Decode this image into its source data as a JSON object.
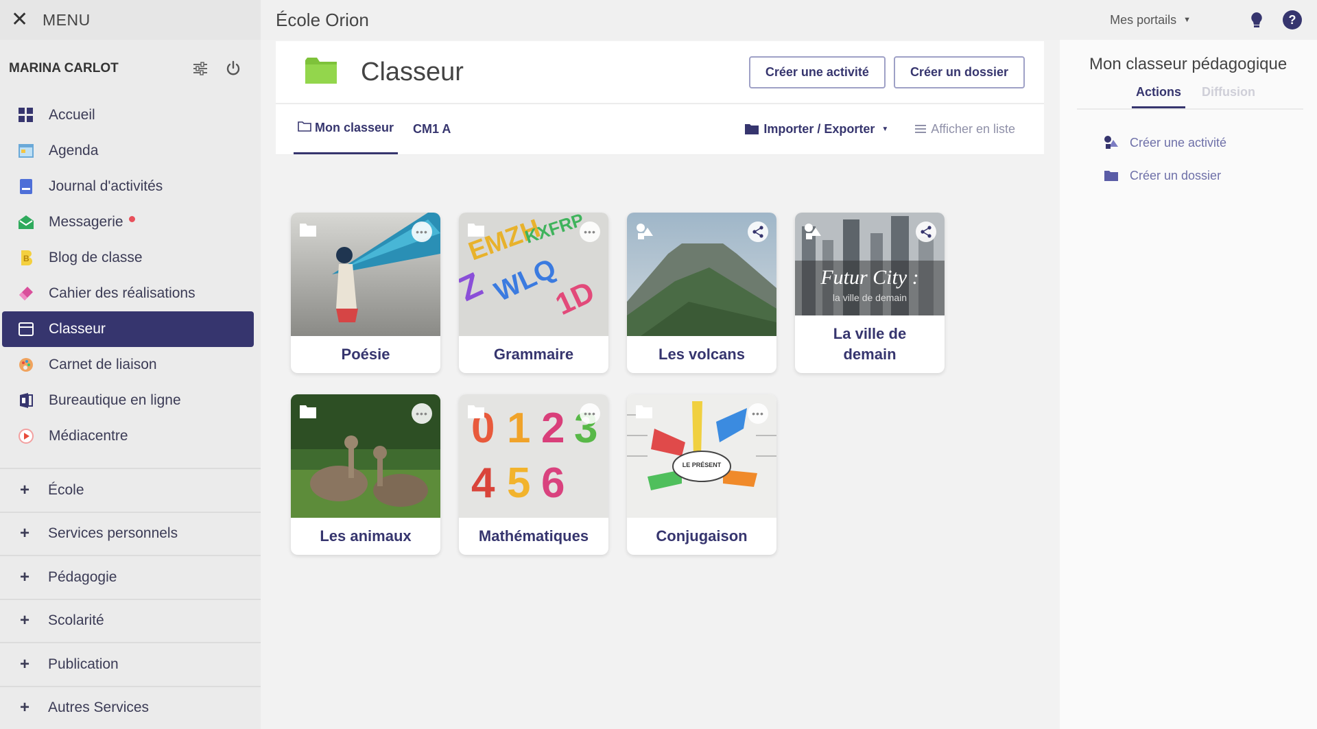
{
  "menu": {
    "label": "MENU"
  },
  "user": {
    "name": "MARINA CARLOT"
  },
  "nav": [
    {
      "label": "Accueil",
      "icon": "dashboard-icon"
    },
    {
      "label": "Agenda",
      "icon": "calendar-icon"
    },
    {
      "label": "Journal d'activités",
      "icon": "journal-icon"
    },
    {
      "label": "Messagerie",
      "icon": "mail-icon",
      "badge": true
    },
    {
      "label": "Blog de classe",
      "icon": "blog-icon"
    },
    {
      "label": "Cahier des réalisations",
      "icon": "eraser-icon"
    },
    {
      "label": "Classeur",
      "icon": "binder-icon",
      "active": true
    },
    {
      "label": "Carnet de liaison",
      "icon": "palette-icon"
    },
    {
      "label": "Bureautique en ligne",
      "icon": "office-icon"
    },
    {
      "label": "Médiacentre",
      "icon": "media-icon"
    }
  ],
  "sections": [
    "École",
    "Services personnels",
    "Pédagogie",
    "Scolarité",
    "Publication",
    "Autres Services"
  ],
  "topbar": {
    "school": "École Orion",
    "portals": "Mes portails"
  },
  "header": {
    "title": "Classeur",
    "btn_activity": "Créer une activité",
    "btn_folder": "Créer un dossier"
  },
  "tabs": {
    "mine": "Mon classeur",
    "class": "CM1 A",
    "import": "Importer / Exporter",
    "list": "Afficher en liste"
  },
  "cards": [
    {
      "label": "Poésie",
      "type": "folder"
    },
    {
      "label": "Grammaire",
      "type": "folder"
    },
    {
      "label": "Les volcans",
      "type": "activity",
      "shared": true
    },
    {
      "label": "La ville de demain",
      "type": "activity",
      "shared": true,
      "thumb_title": "Futur City :",
      "thumb_sub": "la ville de demain"
    },
    {
      "label": "Les animaux",
      "type": "folder"
    },
    {
      "label": "Mathématiques",
      "type": "folder"
    },
    {
      "label": "Conjugaison",
      "type": "folder",
      "thumb_text": "LE PRÉSENT"
    }
  ],
  "right_panel": {
    "title": "Mon classeur pédagogique",
    "tab_actions": "Actions",
    "tab_diffusion": "Diffusion",
    "action_activity": "Créer une activité",
    "action_folder": "Créer un dossier"
  },
  "colors": {
    "primary": "#36356e",
    "folder_green": "#7ec23a",
    "badge_red": "#e8505b"
  }
}
